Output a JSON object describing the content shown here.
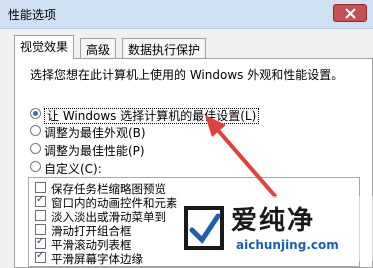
{
  "window": {
    "title": "性能选项"
  },
  "tabs": [
    {
      "label": "视觉效果",
      "active": true
    },
    {
      "label": "高级",
      "active": false
    },
    {
      "label": "数据执行保护",
      "active": false
    }
  ],
  "description": "选择您想在此计算机上使用的 Windows 外观和性能设置。",
  "radios": [
    {
      "label": "让 Windows 选择计算机的最佳设置(L)",
      "checked": true
    },
    {
      "label": "调整为最佳外观(B)",
      "checked": false
    },
    {
      "label": "调整为最佳性能(P)",
      "checked": false
    },
    {
      "label": "自定义(C):",
      "checked": false
    }
  ],
  "options": [
    {
      "label": "保存任务栏缩略图预览",
      "checked": false
    },
    {
      "label": "窗口内的动画控件和元素",
      "checked": true
    },
    {
      "label": "淡入淡出或滑动菜单到",
      "checked": false
    },
    {
      "label": "滑动打开组合框",
      "checked": false
    },
    {
      "label": "平滑滚动列表框",
      "checked": true
    },
    {
      "label": "平滑屏幕字体边缘",
      "checked": true
    }
  ],
  "watermark": {
    "brand": "爱纯净",
    "url": "aichunjing.com"
  },
  "colors": {
    "arrow": "#e0413a",
    "titlebar": "#cfe0f2",
    "close": "#c75050"
  }
}
